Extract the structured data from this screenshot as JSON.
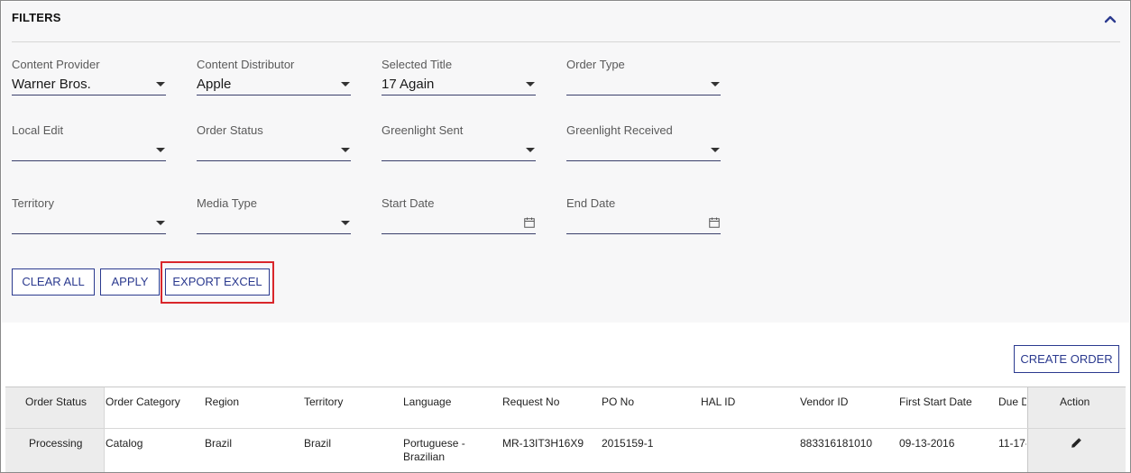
{
  "filters": {
    "title": "FILTERS",
    "fields": {
      "content_provider": {
        "label": "Content Provider",
        "value": "Warner Bros."
      },
      "content_distributor": {
        "label": "Content Distributor",
        "value": "Apple"
      },
      "selected_title": {
        "label": "Selected Title",
        "value": "17 Again"
      },
      "order_type": {
        "label": "Order Type",
        "value": ""
      },
      "local_edit": {
        "label": "Local Edit",
        "value": ""
      },
      "order_status": {
        "label": "Order Status",
        "value": ""
      },
      "greenlight_sent": {
        "label": "Greenlight Sent",
        "value": ""
      },
      "greenlight_received": {
        "label": "Greenlight Received",
        "value": ""
      },
      "territory": {
        "label": "Territory",
        "value": ""
      },
      "media_type": {
        "label": "Media Type",
        "value": ""
      },
      "start_date": {
        "label": "Start Date",
        "value": ""
      },
      "end_date": {
        "label": "End Date",
        "value": ""
      }
    },
    "buttons": {
      "clear_all": "CLEAR ALL",
      "apply": "APPLY",
      "export_excel": "EXPORT EXCEL"
    }
  },
  "create_order_label": "CREATE ORDER",
  "table": {
    "headers": {
      "order_status": "Order Status",
      "order_category": "Order Category",
      "region": "Region",
      "territory": "Territory",
      "language": "Language",
      "request_no": "Request No",
      "po_no": "PO No",
      "hal_id": "HAL ID",
      "vendor_id": "Vendor ID",
      "first_start_date": "First Start Date",
      "due_date": "Due D",
      "action": "Action"
    },
    "rows": [
      {
        "order_status": "Processing",
        "order_category": "Catalog",
        "region": "Brazil",
        "territory": "Brazil",
        "language_line1": "Portuguese -",
        "language_line2": "Brazilian",
        "request_no": "MR-13IT3H16X9",
        "po_no": "2015159-1",
        "hal_id": "",
        "vendor_id": "883316181010",
        "first_start_date": "09-13-2016",
        "due_date": "11-17-"
      }
    ]
  },
  "colors": {
    "accent": "#2b3a8f",
    "highlight": "#d9262b",
    "panel_bg": "#f7f7f8"
  },
  "icons": [
    "chevron-up-icon",
    "dropdown-arrow-icon",
    "calendar-icon",
    "pencil-icon"
  ]
}
